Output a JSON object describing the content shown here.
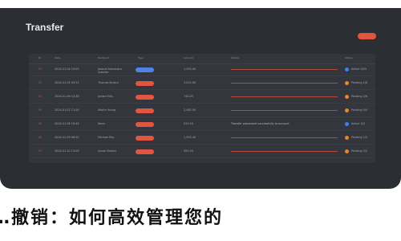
{
  "window": {
    "title": "Transfer"
  },
  "colors": {
    "accent": "#e2553f",
    "window_bg": "#2b2e33",
    "pill_blue": "#4f84e6",
    "pill_red": "#e2553f",
    "dot_orange": "#e08a2c",
    "dot_blue": "#3f7fe8"
  },
  "table": {
    "headers": [
      "ID",
      "Date",
      "Recipient",
      "Type",
      "Amount",
      "Details",
      "Status"
    ],
    "rows": [
      {
        "id": "01",
        "date": "2024-01-04 10:05",
        "name": "Jaxeral Alexandra",
        "name2": "Leonide",
        "pill": "blue",
        "amount": "1,295.00",
        "detail": "redline",
        "dot": "blue",
        "status": "Active 0/25"
      },
      {
        "id": "02",
        "date": "2024-01-05 09:12",
        "name": "Thomas Bryant",
        "pill": "red",
        "amount": "3,010.00",
        "detail": "redline",
        "dot": "orange",
        "status": "Pending 1/8"
      },
      {
        "id": "03",
        "date": "2024-01-06 14:38",
        "name": "Jordan Ellis",
        "pill": "red",
        "amount": "740.25",
        "detail": "redline",
        "dot": "orange",
        "status": "Pending 2/6"
      },
      {
        "id": "04",
        "date": "2024-01-07 11:00",
        "name": "Martin Young",
        "pill": "red",
        "amount": "2,480.00",
        "detail": "redline",
        "dot": "orange",
        "status": "Pending 0/4"
      },
      {
        "id": "05",
        "date": "2024-01-08 16:45",
        "name": "Kevin",
        "pill": "red",
        "amount": "615.00",
        "detail": "Transfer processed successfully to account",
        "dot": "blue",
        "status": "Active 3/3"
      },
      {
        "id": "06",
        "date": "2024-01-09 08:20",
        "name": "Michael Ray",
        "pill": "red",
        "amount": "1,905.40",
        "detail": "redline",
        "dot": "orange",
        "status": "Pending 1/5"
      },
      {
        "id": "07",
        "date": "2024-01-10 13:05",
        "name": "Susan Brooks",
        "pill": "red",
        "amount": "455.00",
        "detail": "redline",
        "dot": "orange",
        "status": "Pending 2/2"
      }
    ]
  },
  "caption": "…撤销：如何高效管理您的"
}
